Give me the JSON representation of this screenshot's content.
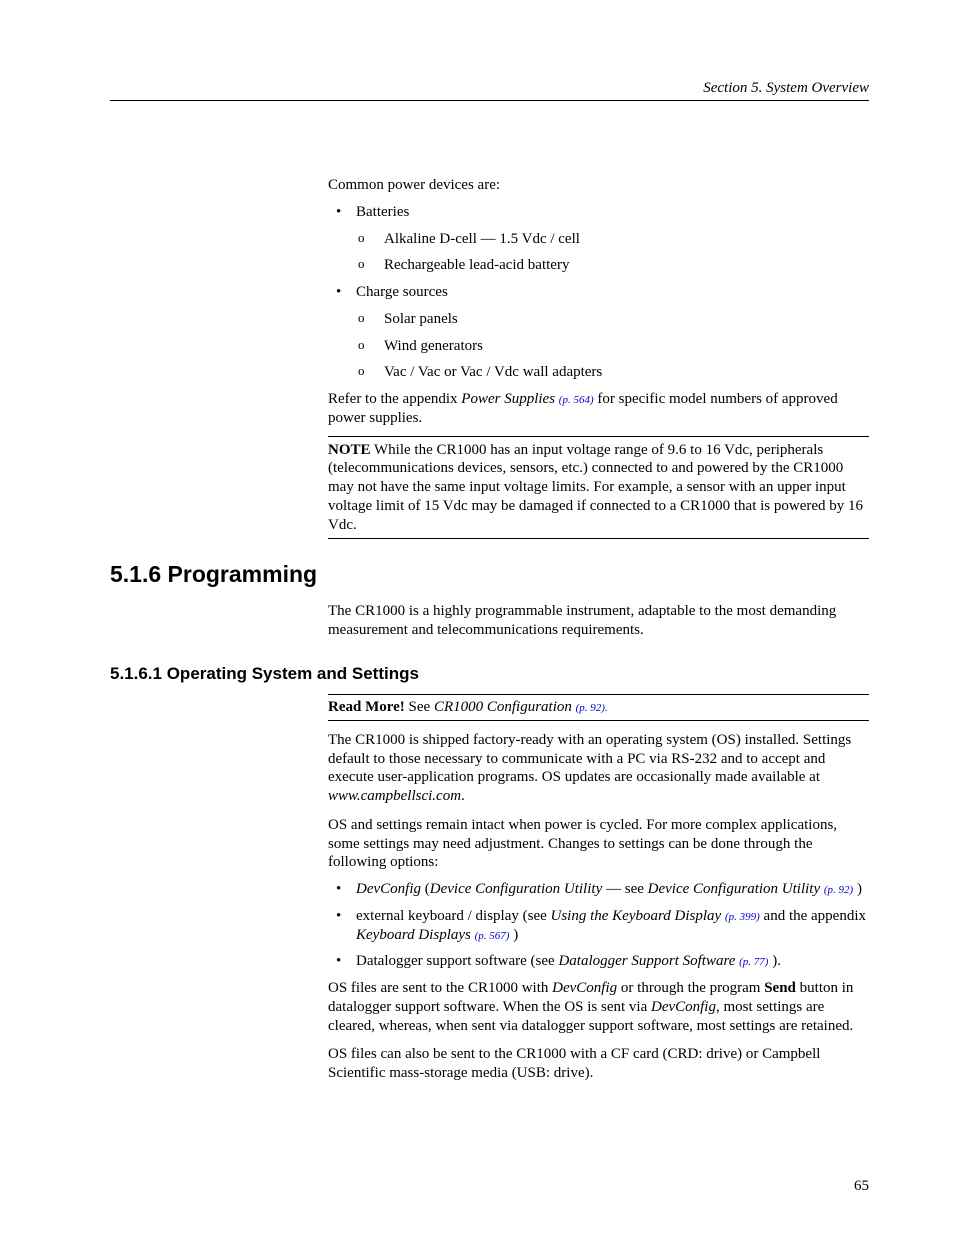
{
  "header": {
    "section_label": "Section 5.  System Overview"
  },
  "intro": {
    "common_power": "Common power devices are:",
    "bullets": {
      "batteries": "Batteries",
      "alkaline": "Alkaline D-cell — 1.5 Vdc / cell",
      "rechargeable": "Rechargeable lead-acid battery",
      "charge_sources": "Charge sources",
      "solar": "Solar panels",
      "wind": "Wind generators",
      "vac": "Vac / Vac or Vac / Vdc wall adapters"
    },
    "refer_pre": "Refer to the appendix ",
    "refer_italic": "Power Supplies ",
    "refer_pref": "(p. 564)",
    "refer_post": " for specific model numbers of approved power supplies."
  },
  "note": {
    "label": "NOTE",
    "text": "  While the CR1000 has an input voltage range of 9.6 to 16 Vdc, peripherals (telecommunications devices, sensors, etc.) connected to and powered by the CR1000 may not have the same input voltage limits. For example, a sensor with an upper input voltage limit of 15 Vdc may be damaged if connected to a CR1000 that is powered by 16 Vdc."
  },
  "programming": {
    "heading": "5.1.6 Programming",
    "para": "The CR1000 is a highly programmable instrument, adaptable to the most demanding measurement and telecommunications requirements."
  },
  "os_settings": {
    "heading": "5.1.6.1 Operating System and Settings",
    "readmore_bold": "Read More!",
    "readmore_pre": " See ",
    "readmore_italic": "CR1000 Configuration ",
    "readmore_pref": "(p. 92).",
    "para1_pre": "The CR1000 is shipped factory-ready with an operating system (OS) installed. Settings default to those necessary to communicate with a PC via RS-232 and to accept and execute user-application programs. OS updates are occasionally made available at ",
    "para1_italic": "www.campbellsci.com",
    "para1_post": ".",
    "para2": "OS and settings remain intact when power is cycled.  For more complex applications, some settings may need adjustment.  Changes to settings can be done through the following options:",
    "bullets": {
      "devconfig_i1": "DevConfig",
      "devconfig_paren1": " (",
      "devconfig_i2": "Device Configuration Utility",
      "devconfig_mid": " — see ",
      "devconfig_i3": "Device Configuration Utility ",
      "devconfig_pref": "(p. 92)",
      "devconfig_end": " )",
      "external_pre": "external keyboard / display (see ",
      "external_i1": "Using the Keyboard Display ",
      "external_pref1": "(p. 399)",
      "external_mid": " and the appendix ",
      "external_i2": "Keyboard Displays ",
      "external_pref2": "(p. 567)",
      "external_end": " )",
      "datalogger_pre": "Datalogger support software (see ",
      "datalogger_i": "Datalogger Support Software ",
      "datalogger_pref": "(p. 77)",
      "datalogger_end": " )."
    },
    "para3_pre": "OS files are sent to the CR1000 with ",
    "para3_i1": "DevConfig",
    "para3_mid1": " or through the program ",
    "para3_bold": "Send",
    "para3_mid2": " button in datalogger support software.  When the OS is sent via ",
    "para3_i2": "DevConfig",
    "para3_end": ", most settings are cleared, whereas, when sent via datalogger support software, most settings are retained.",
    "para4": "OS files can also be sent to the CR1000 with a CF card (CRD: drive) or Campbell Scientific mass-storage media (USB: drive)."
  },
  "page_number": "65"
}
